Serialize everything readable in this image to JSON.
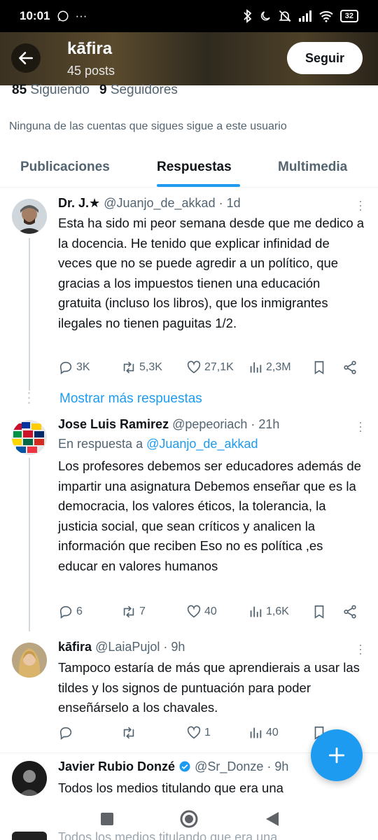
{
  "status_bar": {
    "time": "10:01",
    "battery": "32",
    "ellipsis": "···"
  },
  "header": {
    "profile_name": "kāfira",
    "posts_count": "45 posts",
    "follow_label": "Seguir"
  },
  "stats": {
    "following_count": "85",
    "following_label": "Siguiendo",
    "followers_count": "9",
    "followers_label": "Seguidores"
  },
  "notice": "Ninguna de las cuentas que sigues sigue a este usuario",
  "tabs": [
    {
      "label": "Publicaciones",
      "active": false
    },
    {
      "label": "Respuestas",
      "active": true
    },
    {
      "label": "Multimedia",
      "active": false
    }
  ],
  "tweets": [
    {
      "name": "Dr. J.★",
      "handle_time": "@Juanjo_de_akkad · 1d",
      "reply_to_prefix": "",
      "reply_to_handle": "",
      "text": "Esta ha sido mi peor semana desde que me dedico a la docencia. He tenido que explicar infinidad de veces que no se puede agredir a un político, que gracias a los impuestos tienen una educación gratuita (incluso los libros), que los inmigrantes ilegales no tienen paguitas 1/2.",
      "replies": "3K",
      "retweets": "5,3K",
      "likes": "27,1K",
      "views": "2,3M"
    },
    {
      "name": "Jose Luis Ramirez",
      "handle_time": "@pepeoriach · 21h",
      "reply_to_prefix": "En respuesta a",
      "reply_to_handle": "@Juanjo_de_akkad",
      "text": "Los profesores debemos ser educadores además de impartir una asignatura Debemos enseñar que es la democracia, los valores éticos, la tolerancia, la justicia social, que sean críticos y analicen la información que reciben Eso no es política ,es educar en valores humanos",
      "replies": "6",
      "retweets": "7",
      "likes": "40",
      "views": "1,6K"
    },
    {
      "name": "kāfira",
      "handle_time": "@LaiaPujol · 9h",
      "reply_to_prefix": "",
      "reply_to_handle": "",
      "text": "Tampoco estaría de más que aprendierais a usar las tildes y los signos de puntuación para poder enseñárselo a los chavales.",
      "replies": "",
      "retweets": "",
      "likes": "1",
      "views": "40"
    },
    {
      "name": "Javier Rubio Donzé",
      "handle_time": "@Sr_Donze · 9h",
      "reply_to_prefix": "",
      "reply_to_handle": "",
      "text": "Todos los medios titulando que era una"
    }
  ],
  "show_more": "Mostrar más respuestas",
  "colors": {
    "accent": "#1d9bf0",
    "text_primary": "#0f1419",
    "text_secondary": "#536471"
  },
  "icons": [
    "back-arrow-icon",
    "reply-icon",
    "retweet-icon",
    "like-icon",
    "views-icon",
    "bookmark-icon",
    "share-icon",
    "more-icon",
    "verified-icon",
    "compose-plus-icon"
  ]
}
